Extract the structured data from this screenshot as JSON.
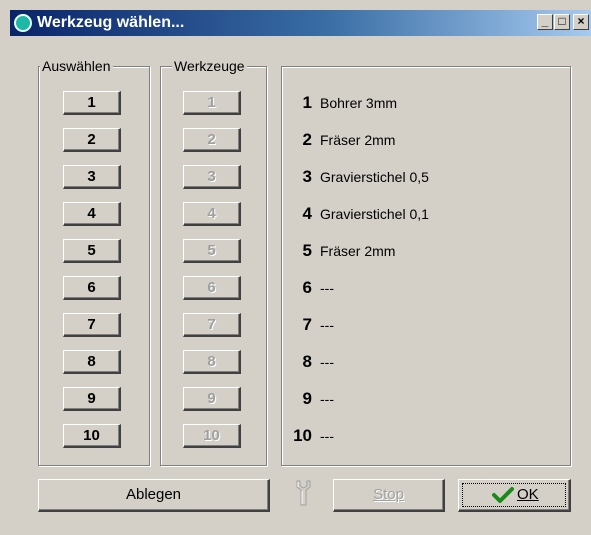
{
  "window": {
    "title": "Werkzeug wählen...",
    "minimize": "_",
    "maximize": "□",
    "close": "×"
  },
  "select_group": {
    "legend": "Auswählen",
    "buttons": [
      "1",
      "2",
      "3",
      "4",
      "5",
      "6",
      "7",
      "8",
      "9",
      "10"
    ]
  },
  "tools_group": {
    "legend": "Werkzeuge",
    "buttons": [
      "1",
      "2",
      "3",
      "4",
      "5",
      "6",
      "7",
      "8",
      "9",
      "10"
    ]
  },
  "tool_list": [
    {
      "number": "1",
      "name": "Bohrer 3mm"
    },
    {
      "number": "2",
      "name": "Fräser 2mm"
    },
    {
      "number": "3",
      "name": "Gravierstichel 0,5"
    },
    {
      "number": "4",
      "name": "Gravierstichel 0,1"
    },
    {
      "number": "5",
      "name": "Fräser 2mm"
    },
    {
      "number": "6",
      "name": "---"
    },
    {
      "number": "7",
      "name": "---"
    },
    {
      "number": "8",
      "name": "---"
    },
    {
      "number": "9",
      "name": "---"
    },
    {
      "number": "10",
      "name": "---"
    }
  ],
  "footer": {
    "ablegen_label": "Ablegen",
    "stop_label": "Stop",
    "ok_label": "OK"
  },
  "icons": {
    "app": "app-icon",
    "wrench": "wrench-icon",
    "check": "check-icon"
  },
  "colors": {
    "titlebar_start": "#0a246a",
    "titlebar_end": "#a6caf0",
    "dialog_bg": "#d4d0c8",
    "check_green": "#1a8a1a"
  }
}
